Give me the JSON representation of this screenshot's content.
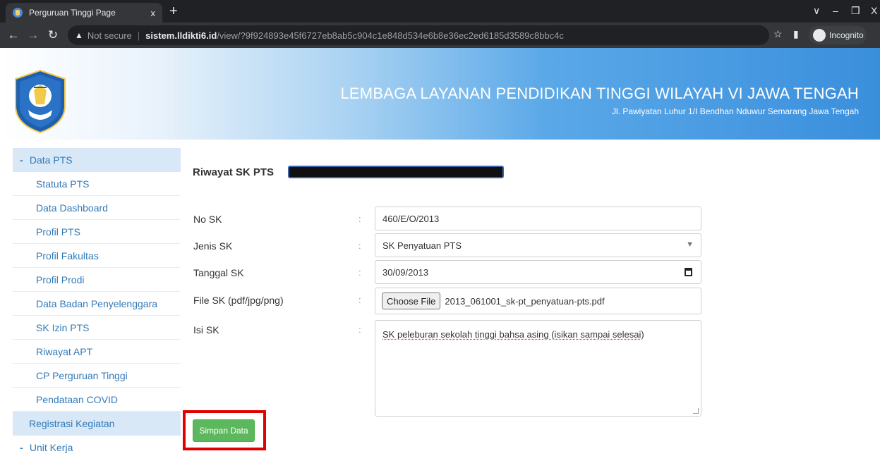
{
  "browser": {
    "tab_title": "Perguruan Tinggi Page",
    "tab_close": "x",
    "new_tab": "+",
    "security_label": "Not secure",
    "url_host": "sistem.lldikti6.id",
    "url_path": "/view/?9f924893e45f6727eb8ab5c904c1e848d534e6b8e36ec2ed6185d3589c8bbc4c",
    "incognito_label": "Incognito"
  },
  "header": {
    "title": "LEMBAGA LAYANAN PENDIDIKAN TINGGI WILAYAH VI JAWA TENGAH",
    "address": "Jl. Pawiyatan Luhur 1/I Bendhan Nduwur Semarang Jawa Tengah"
  },
  "sidebar": {
    "group1": "Data PTS",
    "items": [
      "Statuta PTS",
      "Data Dashboard",
      "Profil PTS",
      "Profil Fakultas",
      "Profil Prodi",
      "Data Badan Penyelenggara",
      "SK Izin PTS",
      "Riwayat APT",
      "CP Perguruan Tinggi",
      "Pendataan COVID"
    ],
    "registrasi": "Registrasi Kegiatan",
    "group2": "Unit Kerja"
  },
  "form": {
    "heading": "Riwayat SK PTS",
    "colon": ":",
    "no_sk_label": "No SK",
    "no_sk_value": "460/E/O/2013",
    "jenis_sk_label": "Jenis SK",
    "jenis_sk_value": "SK Penyatuan PTS",
    "tanggal_sk_label": "Tanggal SK",
    "tanggal_sk_value": "30/09/2013",
    "file_sk_label": "File SK (pdf/jpg/png)",
    "choose_file_label": "Choose File",
    "file_name": "2013_061001_sk-pt_penyatuan-pts.pdf",
    "isi_sk_label": "Isi SK",
    "isi_sk_value": "SK peleburan sekolah tinggi bahsa asing (isikan sampai selesai)",
    "save_label": "Simpan Data"
  }
}
